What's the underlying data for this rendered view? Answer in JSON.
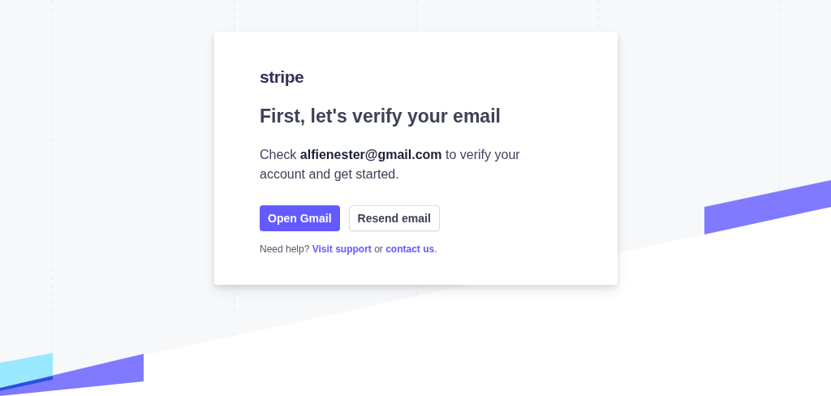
{
  "logo": "stripe",
  "title": "First, let's verify your email",
  "message": "Check **alfienester@gmail.com** to verify your account and get started.",
  "buttons": [
    {
      "label": "Open Gmail",
      "kind": "primary"
    },
    {
      "label": "Resend email",
      "kind": "secondary"
    }
  ],
  "help": [
    {
      "kind": "text",
      "text": "Need help? "
    },
    {
      "kind": "link",
      "text": "Visit support"
    },
    {
      "kind": "text",
      "text": " or "
    },
    {
      "kind": "link",
      "text": "contact us"
    },
    {
      "kind": "text",
      "text": "."
    }
  ]
}
